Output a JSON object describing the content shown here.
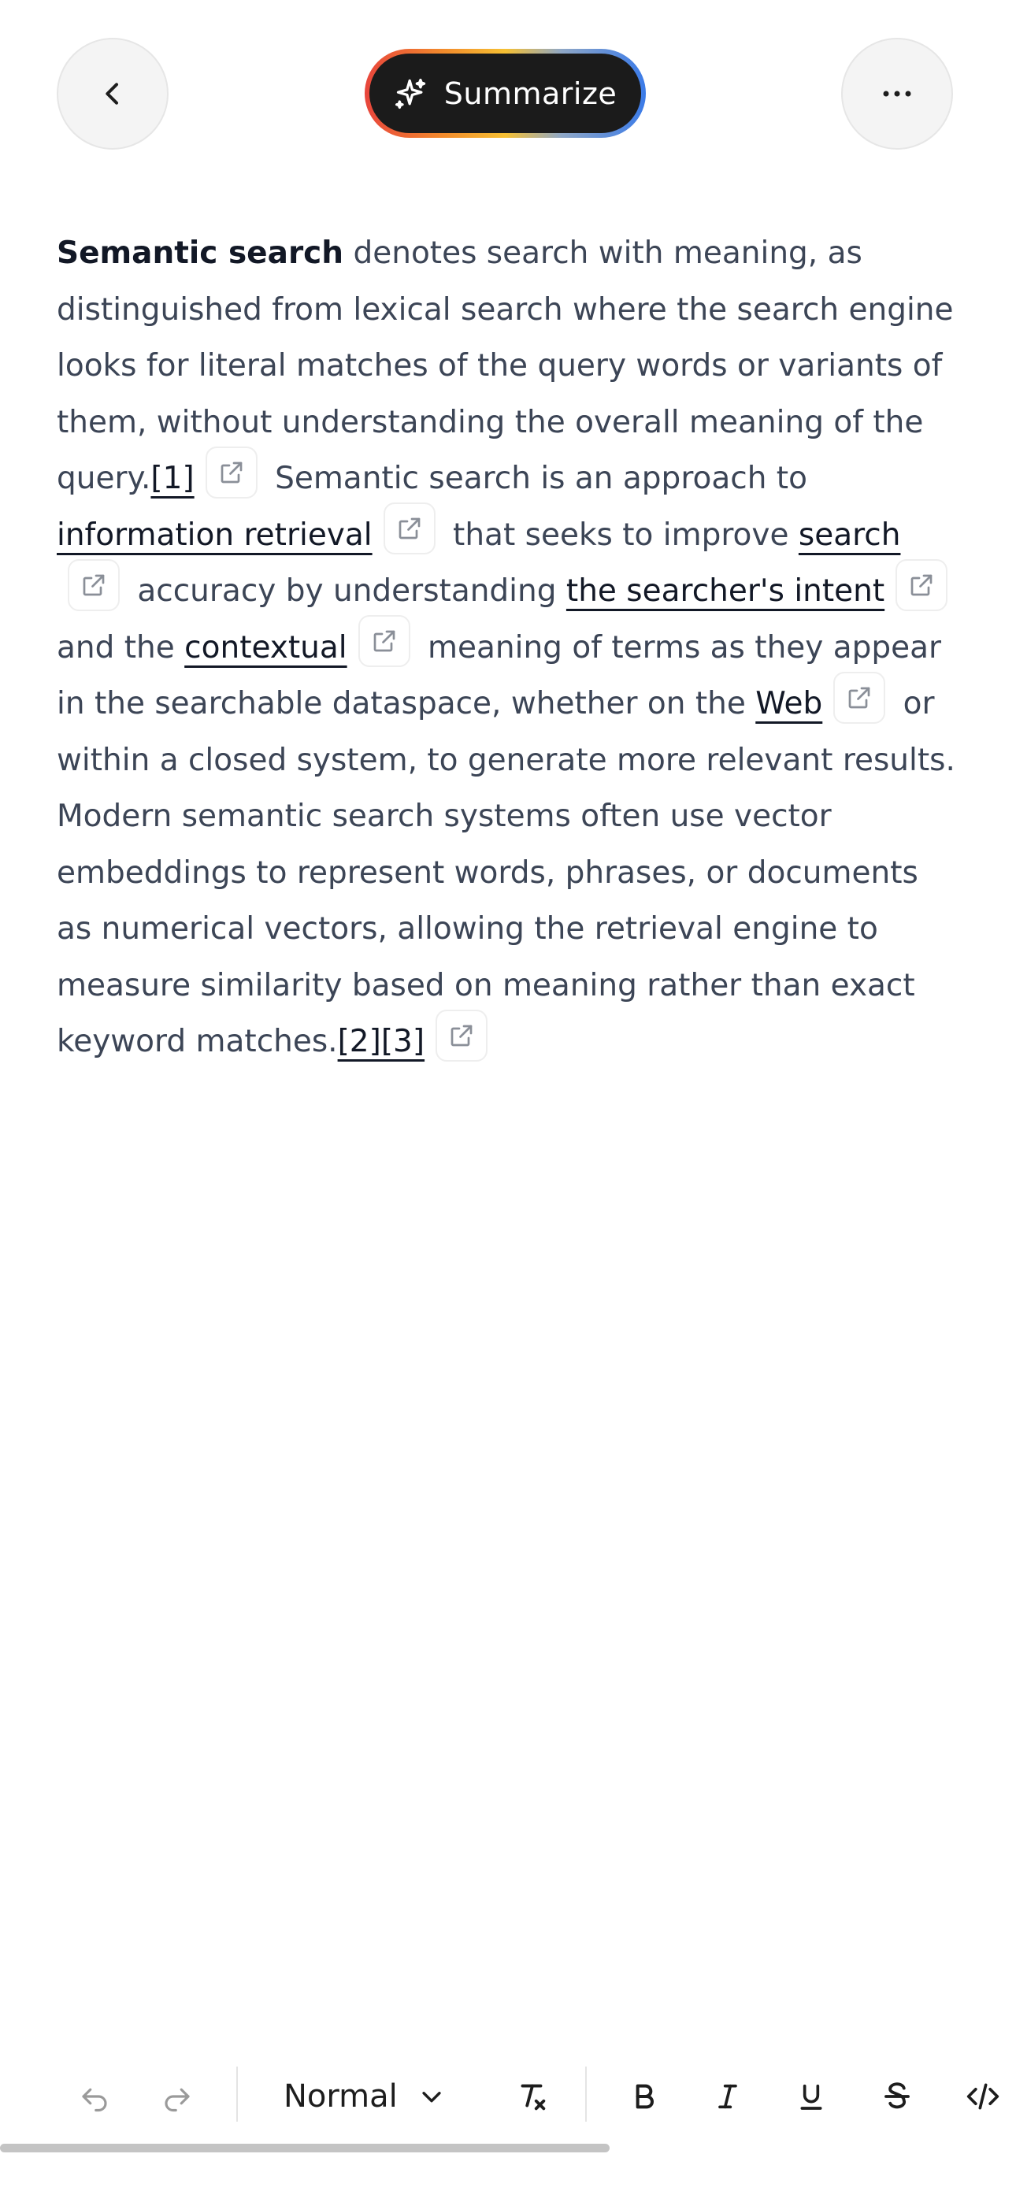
{
  "header": {
    "back_icon": "chevron-left-icon",
    "summarize_label": "Summarize",
    "summarize_icon": "sparkle-icon",
    "more_icon": "more-horizontal-icon",
    "summarize_gradient": [
      "#e8453c",
      "#f28b2c",
      "#f6c033",
      "#3b7be8"
    ]
  },
  "article": {
    "term": "Semantic search",
    "t1": " denotes search with meaning, as distinguished from lexical search where the search engine looks for literal matches of the query words or variants of them, without understanding the overall meaning of the query.",
    "ref1": "[1]",
    "t2": " Semantic search is an approach to ",
    "link_information_retrieval": "information retrieval",
    "t3": " that seeks to improve ",
    "link_search": "search",
    "t4": " accuracy by understanding ",
    "link_searchers_intent": "the searcher's intent",
    "t5": " and the ",
    "link_contextual": "contextual",
    "t6": " meaning of terms as they appear in the searchable dataspace, whether on the ",
    "link_web": "Web",
    "t7": " or within a closed system, to generate more relevant results. Modern semantic search systems often use vector embeddings to represent words, phrases, or documents as numerical vectors, allowing the retrieval engine to measure similarity based on meaning rather than exact keyword matches.",
    "ref23": "[2][3]",
    "external_link_icon": "external-link-icon"
  },
  "toolbar": {
    "undo_icon": "undo-icon",
    "redo_icon": "redo-icon",
    "format_value": "Normal",
    "format_chevron_icon": "chevron-down-icon",
    "clear_format_icon": "clear-formatting-icon",
    "bold_icon": "bold-icon",
    "italic_icon": "italic-icon",
    "underline_icon": "underline-icon",
    "strikethrough_icon": "strikethrough-icon",
    "code_icon": "code-icon"
  }
}
